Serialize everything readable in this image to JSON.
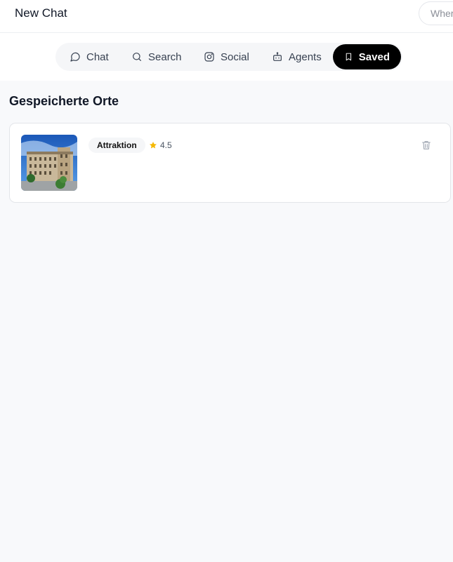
{
  "header": {
    "title": "New Chat",
    "where_text": "Wher"
  },
  "nav": {
    "tabs": [
      {
        "label": "Chat",
        "icon": "message-circle-icon"
      },
      {
        "label": "Search",
        "icon": "search-icon"
      },
      {
        "label": "Social",
        "icon": "instagram-icon"
      },
      {
        "label": "Agents",
        "icon": "bot-icon"
      },
      {
        "label": "Saved",
        "icon": "bookmark-icon",
        "active": true
      }
    ]
  },
  "saved": {
    "title": "Gespeicherte Orte",
    "items": [
      {
        "category": "Attraktion",
        "rating": "4.5",
        "image": "building-photo",
        "delete_icon": "trash-icon"
      }
    ]
  },
  "colors": {
    "active_tab_bg": "#000000",
    "star": "#f5b800",
    "page_bg": "#f8f9fb"
  }
}
